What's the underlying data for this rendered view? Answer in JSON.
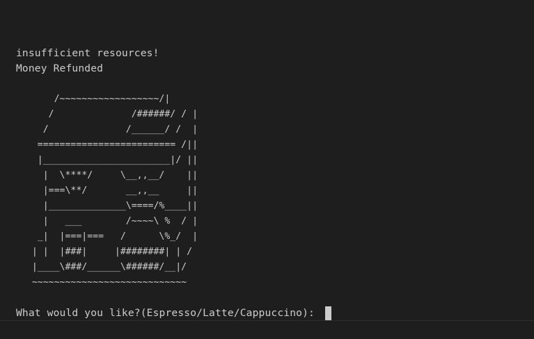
{
  "terminal": {
    "messages": [
      "insufficient resources!",
      "Money Refunded"
    ],
    "ascii_art": "       /~~~~~~~~~~~~~~~~~~/|\n      /              /######/ / |\n     /              /______/ /  |\n    ========================= /||\n    |_______________________|/ ||\n     |  \\****/     \\__,,__/    ||\n     |===\\**/       __,,__     ||\n     |______________\\====/%____||\n     |   ___        /~~~~\\ %  / |\n    _|  |===|===   /      \\%_/  |\n   | |  |###|     |########| | /\n   |____\\###/______\\######/__|/\n   ~~~~~~~~~~~~~~~~~~~~~~~~~~~~",
    "prompt": "What would you like?(Espresso/Latte/Cappuccino): "
  }
}
